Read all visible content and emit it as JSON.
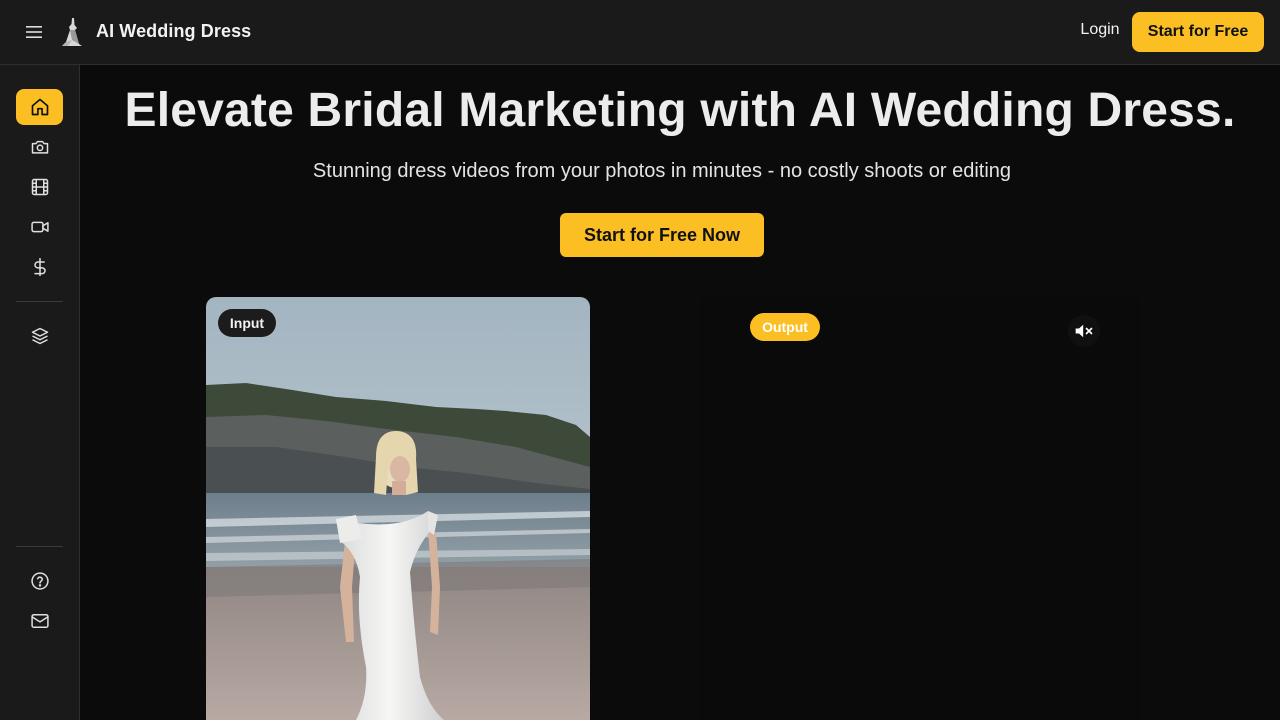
{
  "header": {
    "menu_icon": "hamburger-menu-icon",
    "logo_icon": "wedding-dress-logo",
    "brand": "AI Wedding Dress",
    "login": "Login",
    "start_button": "Start for Free"
  },
  "sidebar": {
    "items": [
      {
        "icon": "home-icon",
        "active": true
      },
      {
        "icon": "camera-icon",
        "active": false
      },
      {
        "icon": "film-icon",
        "active": false
      },
      {
        "icon": "video-camera-icon",
        "active": false
      },
      {
        "icon": "dollar-icon",
        "active": false
      },
      {
        "icon": "layers-icon",
        "active": false
      },
      {
        "icon": "help-circle-icon",
        "active": false
      },
      {
        "icon": "mail-icon",
        "active": false
      }
    ]
  },
  "hero": {
    "title": "Elevate Bridal Marketing with AI Wedding Dress.",
    "subtitle": "Stunning dress videos from your photos in minutes - no costly shoots or editing",
    "cta": "Start for Free Now"
  },
  "demo": {
    "input_label": "Input",
    "output_label": "Output",
    "mute_icon": "volume-muted-icon"
  },
  "colors": {
    "accent": "#fbbf24",
    "background": "#0b0b0b",
    "panel": "#1a1a1a"
  }
}
